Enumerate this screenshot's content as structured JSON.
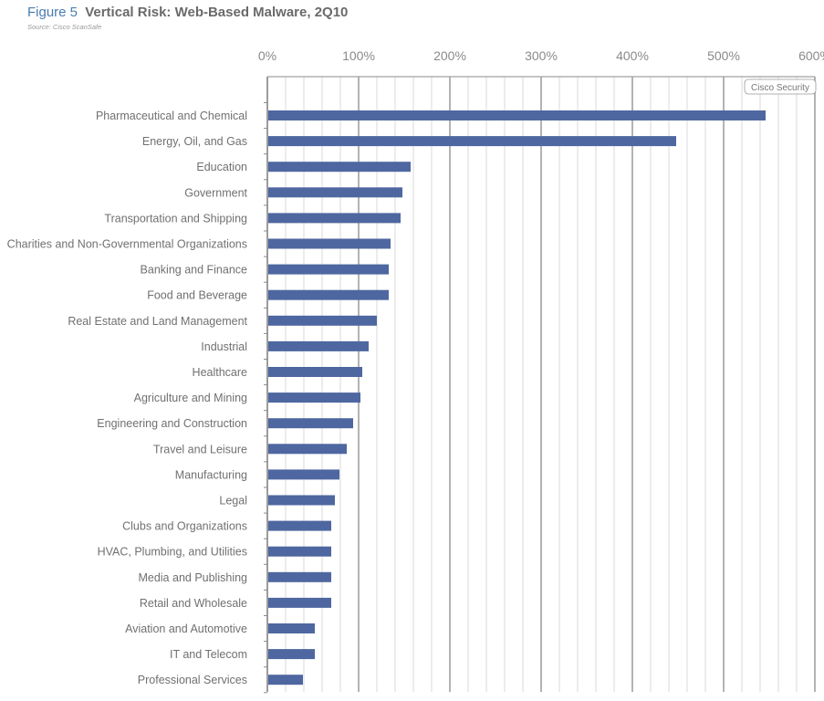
{
  "figure": {
    "number": "Figure 5",
    "title": "Vertical Risk: Web-Based Malware, 2Q10",
    "source": "Source: Cisco ScanSafe",
    "badge": "Cisco Security"
  },
  "colors": {
    "bar": "#4e67a0",
    "major_grid": "#a0a0a0",
    "minor_grid": "#d8d8d8",
    "axis": "#8a8a8a"
  },
  "chart_data": {
    "type": "bar",
    "orientation": "horizontal",
    "title": "Vertical Risk: Web-Based Malware, 2Q10",
    "xlabel": "",
    "ylabel": "",
    "xlim": [
      0,
      600
    ],
    "x_ticks": [
      0,
      100,
      200,
      300,
      400,
      500,
      600
    ],
    "x_tick_labels": [
      "0%",
      "100%",
      "200%",
      "300%",
      "400%",
      "500%",
      "600%"
    ],
    "minor_step": 20,
    "grid": true,
    "x_axis_position": "top",
    "categories": [
      "Pharmaceutical and Chemical",
      "Energy, Oil, and Gas",
      "Education",
      "Government",
      "Transportation and Shipping",
      "Charities and Non-Governmental Organizations",
      "Banking and Finance",
      "Food and Beverage",
      "Real Estate and Land Management",
      "Industrial",
      "Healthcare",
      "Agriculture and Mining",
      "Engineering and Construction",
      "Travel and Leisure",
      "Manufacturing",
      "Legal",
      "Clubs and Organizations",
      "HVAC, Plumbing, and Utilities",
      "Media and Publishing",
      "Retail and Wholesale",
      "Aviation and Automotive",
      "IT and Telecom",
      "Professional Services"
    ],
    "values": [
      546,
      448,
      157,
      148,
      146,
      135,
      133,
      133,
      120,
      111,
      104,
      102,
      94,
      87,
      79,
      74,
      70,
      70,
      70,
      70,
      52,
      52,
      39
    ],
    "unit": "%"
  }
}
